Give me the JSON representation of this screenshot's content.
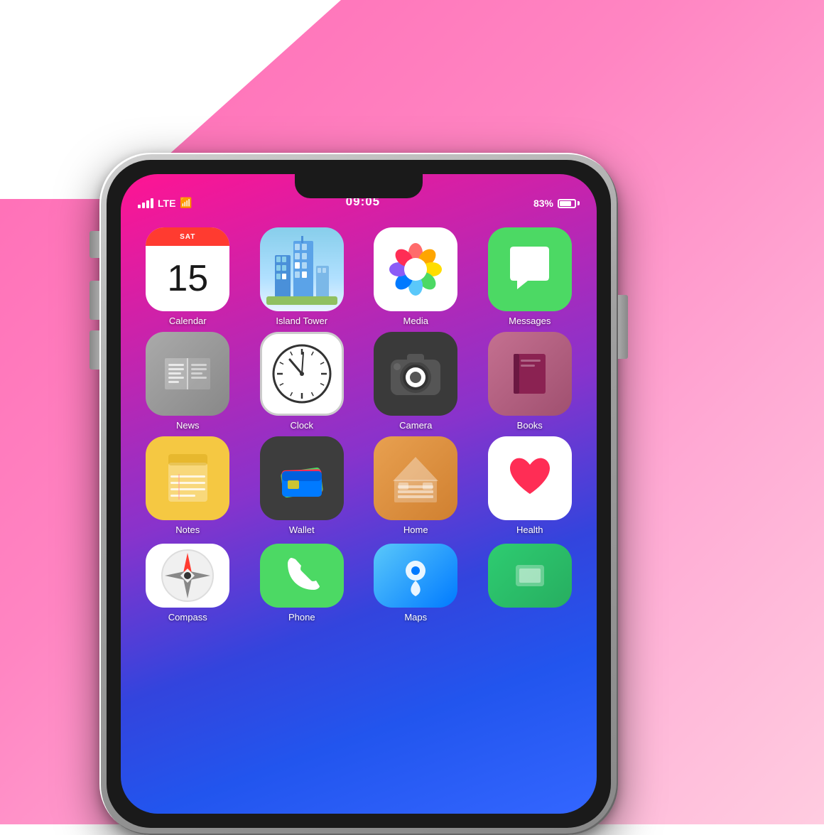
{
  "background": {
    "gradient": "linear-gradient(135deg, #ff69b4, #ffaad4)"
  },
  "status_bar": {
    "signal": "●●●●",
    "network": "LTE",
    "wifi": "WiFi",
    "time": "09:05",
    "battery_percent": "83%"
  },
  "apps": [
    {
      "row": 1,
      "items": [
        {
          "id": "calendar",
          "label": "Calendar",
          "date": "15"
        },
        {
          "id": "island-tower",
          "label": "Island Tower"
        },
        {
          "id": "media",
          "label": "Media"
        },
        {
          "id": "messages",
          "label": "Messages"
        }
      ]
    },
    {
      "row": 2,
      "items": [
        {
          "id": "news",
          "label": "News"
        },
        {
          "id": "clock",
          "label": "Clock"
        },
        {
          "id": "camera",
          "label": "Camera"
        },
        {
          "id": "books",
          "label": "Books"
        }
      ]
    },
    {
      "row": 3,
      "items": [
        {
          "id": "notes",
          "label": "Notes"
        },
        {
          "id": "wallet",
          "label": "Wallet"
        },
        {
          "id": "home",
          "label": "Home"
        },
        {
          "id": "health",
          "label": "Health"
        }
      ]
    },
    {
      "row": 4,
      "items": [
        {
          "id": "compass",
          "label": "Compass"
        },
        {
          "id": "phone",
          "label": "Phone"
        },
        {
          "id": "maps",
          "label": "Maps"
        },
        {
          "id": "unknown",
          "label": ""
        }
      ]
    }
  ]
}
